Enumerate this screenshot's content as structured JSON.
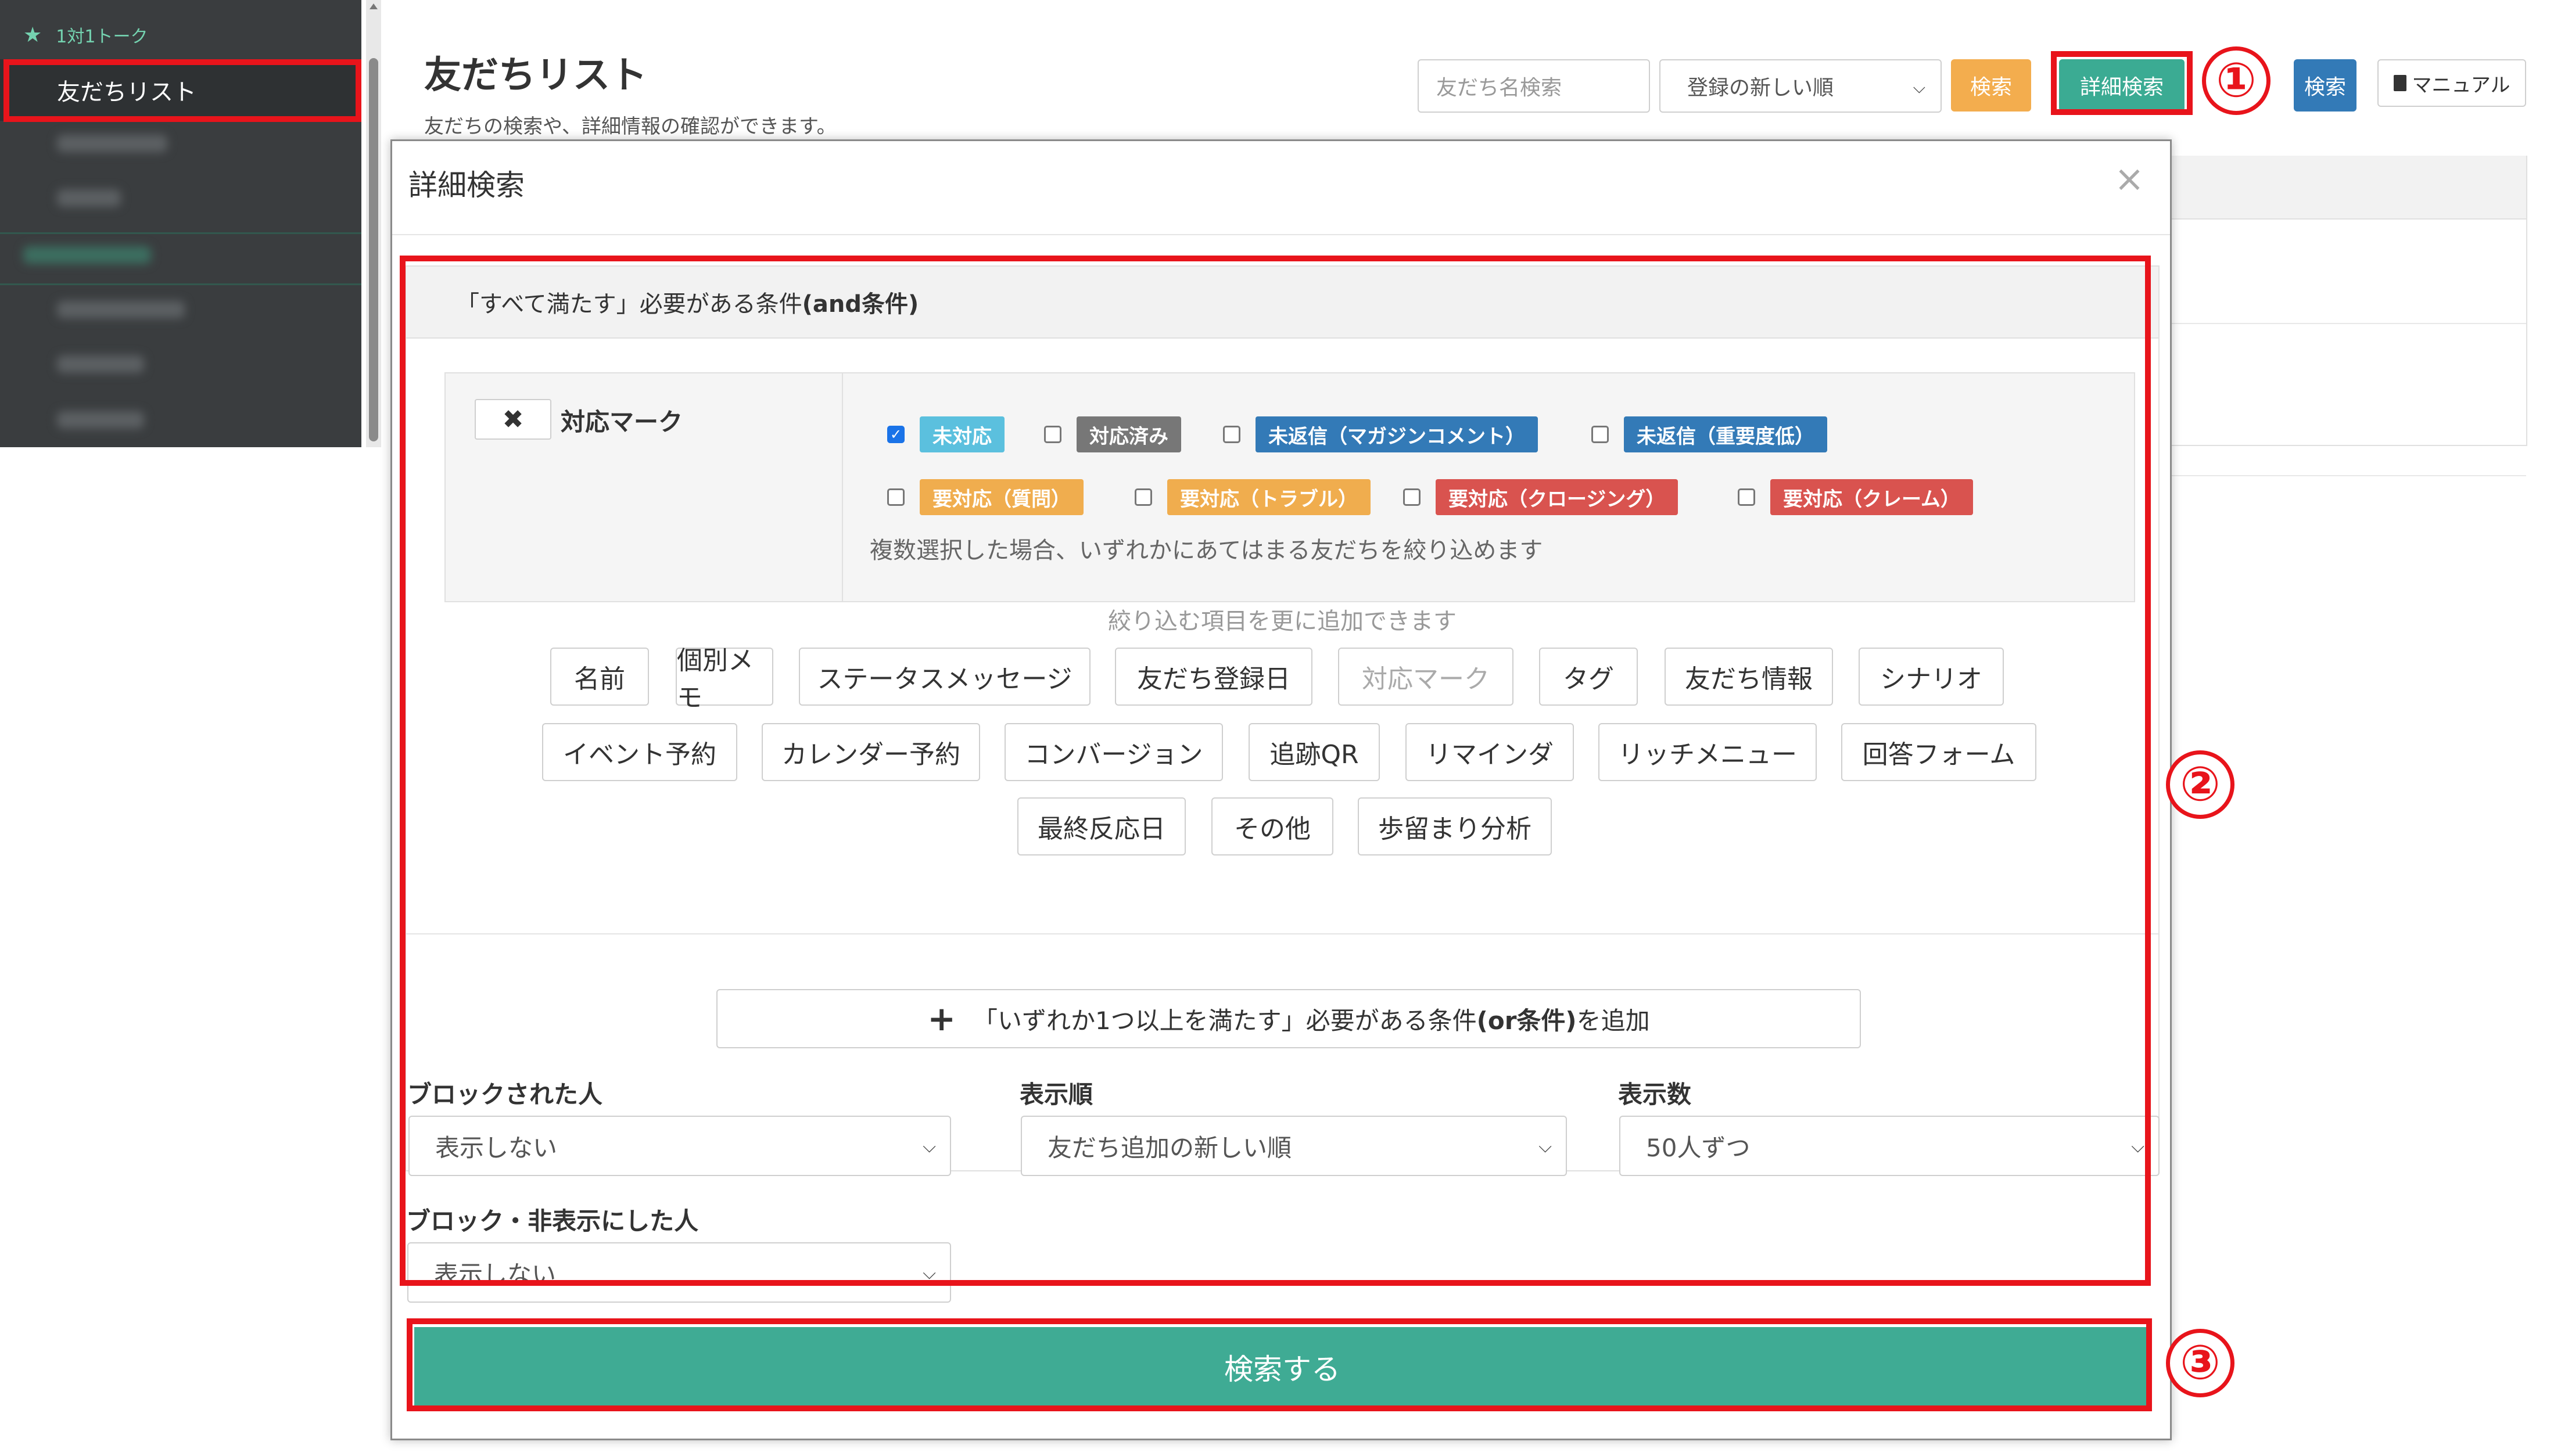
{
  "sidebar": {
    "section_label": "1対1トーク",
    "active_item": "友だちリスト"
  },
  "header": {
    "title": "友だちリスト",
    "subtitle": "友だちの検索や、詳細情報の確認ができます。",
    "search_placeholder": "友だち名検索",
    "sort_value": "登録の新しい順",
    "search_button": "検索",
    "advanced_button": "詳細検索",
    "blue_button": "検索",
    "manual_button": "マニュアル"
  },
  "annotations": {
    "step1": "①",
    "step2": "②",
    "step3": "③"
  },
  "modal": {
    "title": "詳細検索",
    "close": "×",
    "and_header_prefix": "「すべて満たす」必要がある条件 ",
    "and_header_bold": "(and条件)",
    "condition": {
      "remove": "✖",
      "label": "対応マーク",
      "marks": [
        {
          "label": "未対応",
          "checked": true,
          "color": "#5bc0de"
        },
        {
          "label": "対応済み",
          "checked": false,
          "color": "#777777"
        },
        {
          "label": "未返信（マガジンコメント）",
          "checked": false,
          "color": "#337ab7"
        },
        {
          "label": "未返信（重要度低）",
          "checked": false,
          "color": "#337ab7"
        },
        {
          "label": "要対応（質問）",
          "checked": false,
          "color": "#f0ad4e"
        },
        {
          "label": "要対応（トラブル）",
          "checked": false,
          "color": "#f0ad4e"
        },
        {
          "label": "要対応（クロージング）",
          "checked": false,
          "color": "#d9534f"
        },
        {
          "label": "要対応（クレーム）",
          "checked": false,
          "color": "#d9534f"
        }
      ],
      "note": "複数選択した場合、いずれかにあてはまる友だちを絞り込めます"
    },
    "add_hint": "絞り込む項目を更に追加できます",
    "filter_buttons": [
      "名前",
      "個別メモ",
      "ステータスメッセージ",
      "友だち登録日",
      "対応マーク",
      "タグ",
      "友だち情報",
      "シナリオ",
      "イベント予約",
      "カレンダー予約",
      "コンバージョン",
      "追跡QR",
      "リマインダ",
      "リッチメニュー",
      "回答フォーム",
      "最終反応日",
      "その他",
      "歩留まり分析"
    ],
    "or_button_prefix": "「いずれか1つ以上を満たす」必要がある条件",
    "or_button_bold": "(or条件)",
    "or_button_suffix": "を追加",
    "blocked": {
      "label": "ブロックされた人",
      "value": "表示しない"
    },
    "order": {
      "label": "表示順",
      "value": "友だち追加の新しい順"
    },
    "count": {
      "label": "表示数",
      "value": "50人ずつ"
    },
    "hidden": {
      "label": "ブロック・非表示にした人",
      "value": "表示しない"
    },
    "submit": "検索する"
  }
}
